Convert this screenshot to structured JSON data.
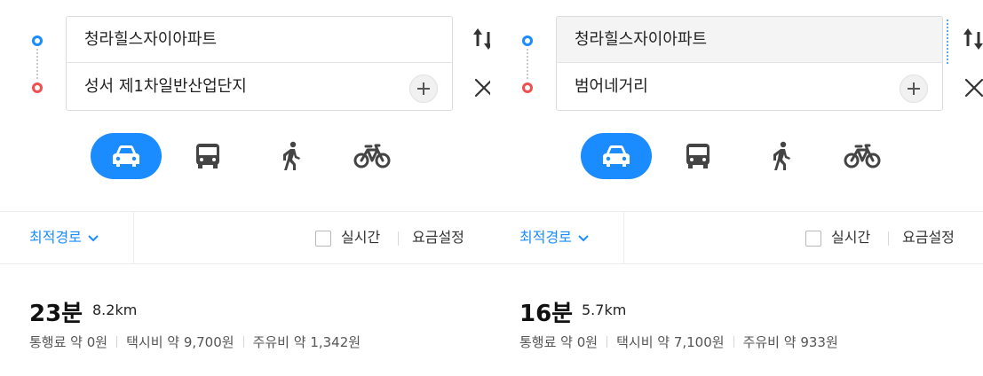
{
  "colors": {
    "accent": "#1a8cff",
    "start_dot": "#1a8cff",
    "end_dot": "#f0504f",
    "icon_gray": "#444444"
  },
  "panels": [
    {
      "origin_value": "청라힐스자이아파트",
      "destination_value": "성서 제1차일반산업단지",
      "origin_active": false,
      "add_waypoint_icon": "plus-icon",
      "swap_icon": "swap-arrows-icon",
      "close_icon": "close-icon",
      "modes": [
        {
          "name": "car",
          "icon": "car-icon",
          "selected": true
        },
        {
          "name": "bus",
          "icon": "bus-icon",
          "selected": false
        },
        {
          "name": "walk",
          "icon": "walk-icon",
          "selected": false
        },
        {
          "name": "bike",
          "icon": "bike-icon",
          "selected": false
        }
      ],
      "route_option": "최적경로",
      "realtime_label": "실시간",
      "realtime_checked": false,
      "fare_setting": "요금설정",
      "duration": "23분",
      "distance": "8.2km",
      "toll": "통행료 약 0원",
      "taxi": "택시비 약 9,700원",
      "fuel": "주유비 약 1,342원"
    },
    {
      "origin_value": "청라힐스자이아파트",
      "destination_value": "범어네거리",
      "origin_active": true,
      "add_waypoint_icon": "plus-icon",
      "swap_icon": "swap-arrows-icon",
      "close_icon": "close-icon",
      "modes": [
        {
          "name": "car",
          "icon": "car-icon",
          "selected": true
        },
        {
          "name": "bus",
          "icon": "bus-icon",
          "selected": false
        },
        {
          "name": "walk",
          "icon": "walk-icon",
          "selected": false
        },
        {
          "name": "bike",
          "icon": "bike-icon",
          "selected": false
        }
      ],
      "route_option": "최적경로",
      "realtime_label": "실시간",
      "realtime_checked": false,
      "fare_setting": "요금설정",
      "duration": "16분",
      "distance": "5.7km",
      "toll": "통행료 약 0원",
      "taxi": "택시비 약 7,100원",
      "fuel": "주유비 약 933원"
    }
  ]
}
